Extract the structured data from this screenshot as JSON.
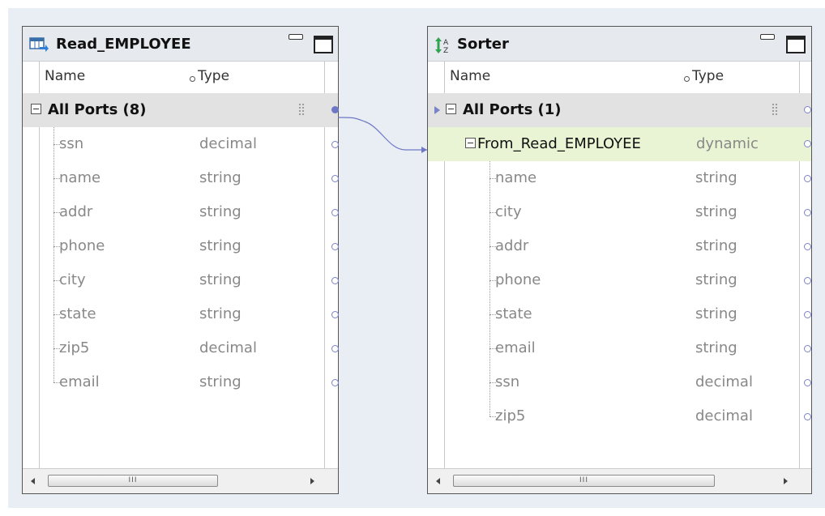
{
  "colors": {
    "canvas": "#e8eef4",
    "link": "#6f78c6",
    "selected_row": "#e9f4d4"
  },
  "left_panel": {
    "title": "Read_EMPLOYEE",
    "icon": "table-read-icon",
    "columns": {
      "name": "Name",
      "type": "Type"
    },
    "group": {
      "label": "All Ports (8)"
    },
    "ports": [
      {
        "name": "ssn",
        "type": "decimal"
      },
      {
        "name": "name",
        "type": "string"
      },
      {
        "name": "addr",
        "type": "string"
      },
      {
        "name": "phone",
        "type": "string"
      },
      {
        "name": "city",
        "type": "string"
      },
      {
        "name": "state",
        "type": "string"
      },
      {
        "name": "zip5",
        "type": "decimal"
      },
      {
        "name": "email",
        "type": "string"
      }
    ],
    "scroll_glyph": "III"
  },
  "right_panel": {
    "title": "Sorter",
    "icon": "sort-az-icon",
    "columns": {
      "name": "Name",
      "type": "Type"
    },
    "group": {
      "label": "All Ports (1)"
    },
    "subgroup": {
      "name": "From_Read_EMPLOYEE",
      "type": "dynamic"
    },
    "ports": [
      {
        "name": "name",
        "type": "string"
      },
      {
        "name": "city",
        "type": "string"
      },
      {
        "name": "addr",
        "type": "string"
      },
      {
        "name": "phone",
        "type": "string"
      },
      {
        "name": "state",
        "type": "string"
      },
      {
        "name": "email",
        "type": "string"
      },
      {
        "name": "ssn",
        "type": "decimal"
      },
      {
        "name": "zip5",
        "type": "decimal"
      }
    ],
    "scroll_glyph": "III"
  }
}
